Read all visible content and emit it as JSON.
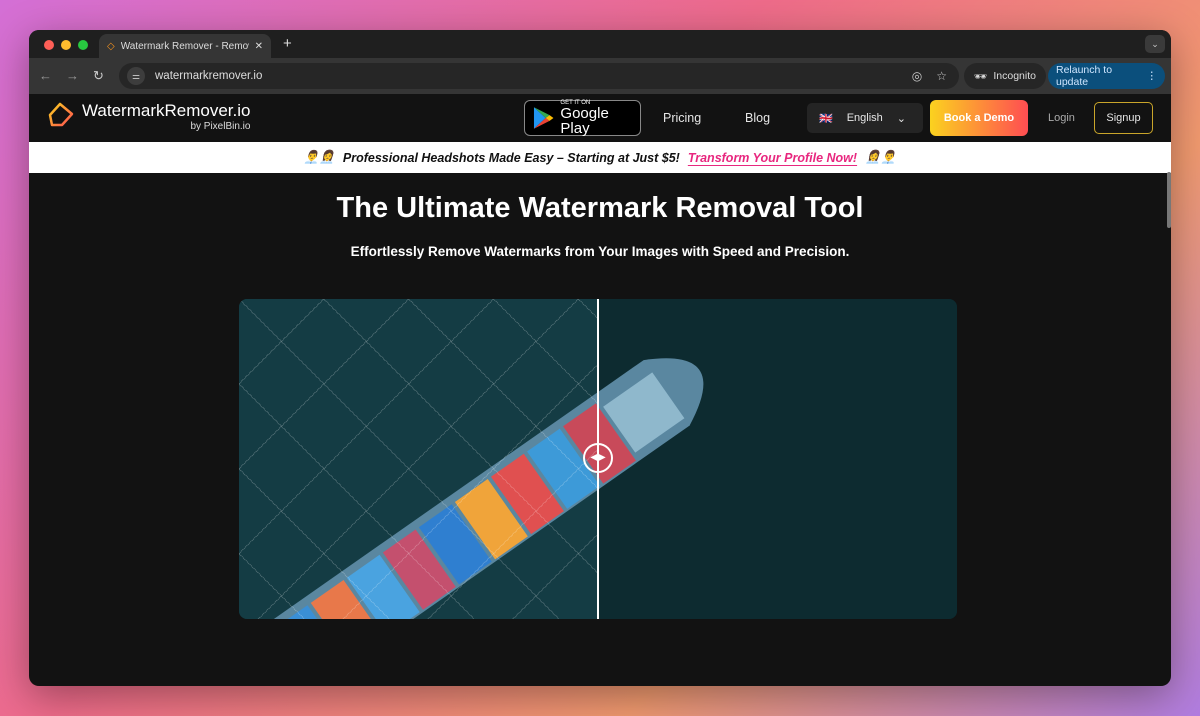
{
  "browser": {
    "tab_title": "Watermark Remover - Remove Watermarks",
    "url": "watermarkremover.io",
    "incognito_label": "Incognito",
    "relaunch_label": "Relaunch to update"
  },
  "header": {
    "logo_name": "WatermarkRemover.io",
    "logo_by": "by PixelBin.io",
    "gplay_top": "GET IT ON",
    "gplay_main": "Google Play",
    "nav": [
      "Pricing",
      "Blog"
    ],
    "language": "English",
    "demo_label": "Book a Demo",
    "login_label": "Login",
    "signup_label": "Signup"
  },
  "banner": {
    "emoji_left": "👨‍💼👩‍💼",
    "text": "Professional Headshots Made Easy – Starting at Just $5!",
    "link": "Transform Your Profile Now!",
    "emoji_right": "👩‍💼👨‍💼"
  },
  "hero": {
    "title": "The Ultimate Watermark Removal Tool",
    "subtitle": "Effortlessly Remove Watermarks from Your Images with Speed and Precision.",
    "comparison_position": 0.5
  },
  "colors": {
    "accent_gradient_start": "#fbd21f",
    "accent_gradient_end": "#ff4d52",
    "banner_link": "#e8277f",
    "signup_border": "#c9a52a"
  }
}
